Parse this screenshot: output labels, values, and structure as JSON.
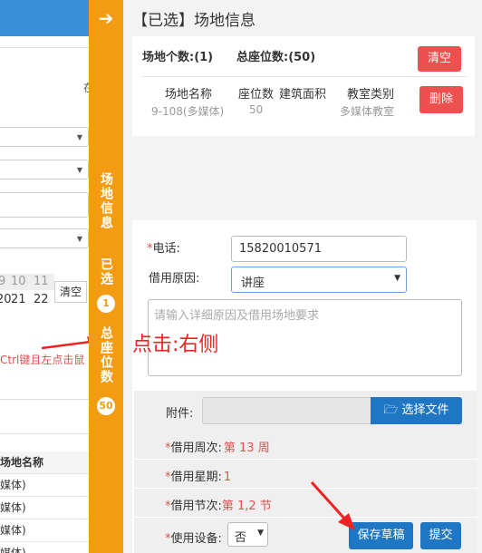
{
  "background_page": {
    "cal_header": [
      "9",
      "10",
      "11"
    ],
    "cal_dates": [
      "20",
      "21",
      "22"
    ],
    "clear_label": "清空",
    "hint": "Ctrl键且左点击鼠",
    "table_header": "场地名称",
    "table_rows": [
      "媒体)",
      "媒体)",
      "媒体)",
      "媒体)"
    ]
  },
  "sidebar": {
    "section1": "场地信息",
    "section2": "已选",
    "badge1": "1",
    "section3": "总座位数",
    "badge2": "50"
  },
  "panel": {
    "title": "【已选】场地信息",
    "summary_venues": "场地个数:(1)",
    "summary_seats": "总座位数:(50)",
    "clear_button": "清空",
    "columns": [
      "场地名称",
      "座位数",
      "建筑面积",
      "教室类别"
    ],
    "row": {
      "name": "9-108(多媒体)",
      "seats": "50",
      "area": "",
      "category": "多媒体教室"
    },
    "delete_button": "删除"
  },
  "form": {
    "phone_label": "电话:",
    "phone_value": "15820010571",
    "reason_label": "借用原因:",
    "reason_value": "讲座",
    "details_placeholder": "请输入详细原因及借用场地要求",
    "attachment_label": "附件:",
    "file_button": "选择文件",
    "week_label": "借用周次:",
    "week_value": "第 13 周",
    "weekday_label": "借用星期:",
    "weekday_value": "1",
    "period_label": "借用节次:",
    "period_value": "第 1,2 节",
    "equipment_label": "使用设备:",
    "equipment_value": "否",
    "save_draft_button": "保存草稿",
    "submit_button": "提交"
  },
  "annotation": {
    "text": "点击:右侧",
    "color": "#ee2222"
  },
  "colors": {
    "sidebar": "#f39c12",
    "danger": "#ee4f4f",
    "primary": "#1f77c4"
  }
}
